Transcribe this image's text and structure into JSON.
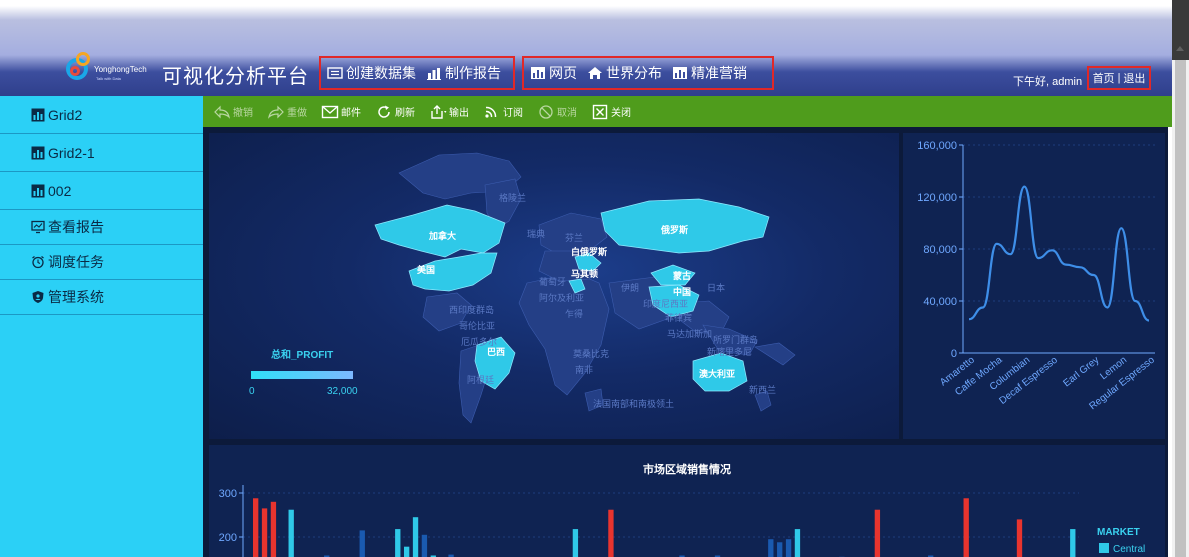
{
  "header": {
    "brand": "YonghongTech",
    "brand_sub": "Talk with Data",
    "title": "可视化分析平台",
    "group1": [
      {
        "label": "创建数据集",
        "icon": "dataset-icon"
      },
      {
        "label": "制作报告",
        "icon": "report-icon"
      }
    ],
    "group2": [
      {
        "label": "网页",
        "icon": "chart-icon"
      },
      {
        "label": "世界分布",
        "icon": "home-icon"
      },
      {
        "label": "精准营销",
        "icon": "chart-icon"
      }
    ],
    "greeting": "下午好, admin",
    "home_link": "首页",
    "separator": "|",
    "logout_link": "退出"
  },
  "sidebar": {
    "items": [
      {
        "label": "Grid2",
        "icon": "chart-icon"
      },
      {
        "label": "Grid2-1",
        "icon": "chart-icon"
      },
      {
        "label": "002",
        "icon": "chart-icon"
      },
      {
        "label": "查看报告",
        "icon": "monitor-icon"
      },
      {
        "label": "调度任务",
        "icon": "alarm-clock-icon"
      },
      {
        "label": "管理系统",
        "icon": "shield-icon"
      }
    ]
  },
  "toolbar": {
    "undo": "撤销",
    "redo": "重做",
    "mail": "邮件",
    "refresh": "刷新",
    "export": "输出",
    "subscribe": "订阅",
    "cancel": "取消",
    "close": "关闭"
  },
  "map": {
    "legend_title": "总和_PROFIT",
    "legend_min": "0",
    "legend_max": "32,000",
    "highlight_color": "#2fc9e8",
    "labels": {
      "canada": "加拿大",
      "usa": "美国",
      "russia": "俄罗斯",
      "belarus": "白俄罗斯",
      "macedonia": "马其顿",
      "mongolia": "蒙古",
      "china": "中国",
      "brazil": "巴西",
      "australia": "澳大利亚",
      "greenland": "格陵兰",
      "sweden": "瑞典",
      "finland": "芬兰",
      "portugal": "葡萄牙",
      "algeria": "阿尔及利亚",
      "chad": "乍得",
      "iran": "伊朗",
      "japan": "日本",
      "india": "印度尼西亚",
      "philippines": "菲律宾",
      "solomon": "所罗门群岛",
      "new_caledonia": "新喀里多尼",
      "madagascar": "马达加斯加",
      "mozambique": "莫桑比克",
      "south_africa": "南非",
      "argentina": "阿根廷",
      "nz": "新西兰",
      "antarctic": "法国南部和南极领土",
      "caribbean": "西印度群岛",
      "colombia": "哥伦比亚",
      "ecuador": "厄瓜多尔"
    }
  },
  "chart_data": [
    {
      "type": "line",
      "categories": [
        "Amaretto",
        "Caffe Mocha",
        "Columbian",
        "Decaf Espresso",
        "Earl Grey",
        "Lemon",
        "Regular Espresso"
      ],
      "x": [
        "Amaretto",
        "",
        "Caffe Mocha",
        "",
        "Columbian",
        "",
        "Decaf Espresso",
        "",
        "",
        "Earl Grey",
        "",
        "Lemon",
        "",
        "Regular Espresso"
      ],
      "values": [
        26000,
        35000,
        84000,
        76000,
        128000,
        73000,
        79000,
        68000,
        66000,
        60000,
        35000,
        96000,
        40000,
        25000
      ],
      "ylim": [
        0,
        160000
      ],
      "yticks": [
        "0",
        "40,000",
        "80,000",
        "120,000",
        "160,000"
      ],
      "color": "#3e8ee8",
      "grid": true
    },
    {
      "type": "bar",
      "title": "市场区域销售情况",
      "ylim": [
        100,
        300
      ],
      "yticks": [
        "200",
        "300"
      ],
      "legend_title": "MARKET",
      "legend": [
        "Central"
      ],
      "legend_colors": [
        "#2fc9e8"
      ],
      "values": [
        288,
        265,
        280,
        0,
        262,
        0,
        150,
        0,
        158,
        0,
        0,
        0,
        215,
        0,
        0,
        0,
        218,
        178,
        245,
        205,
        158,
        0,
        160,
        0,
        0,
        0,
        0,
        0,
        0,
        0,
        0,
        0,
        0,
        0,
        0,
        0,
        218,
        0,
        0,
        0,
        262,
        0,
        0,
        0,
        0,
        0,
        0,
        0,
        158,
        0,
        0,
        0,
        158,
        0,
        0,
        0,
        0,
        0,
        195,
        188,
        195,
        218,
        0,
        0,
        0,
        0,
        155,
        0,
        0,
        0,
        262,
        0,
        0,
        0,
        0,
        0,
        158,
        0,
        0,
        0,
        288,
        0,
        0,
        0,
        0,
        0,
        240,
        0,
        0,
        0,
        0,
        0,
        218
      ],
      "colors": [
        "#e8342e",
        "#e8342e",
        "#e8342e",
        "#0f2352",
        "#2fc9e8",
        "#0f2352",
        "#2fc9e8",
        "#0f2352",
        "#1a5ab0",
        "#0f2352",
        "#0f2352",
        "#0f2352",
        "#1a5ab0",
        "#0f2352",
        "#0f2352",
        "#0f2352",
        "#2fc9e8",
        "#2fc9e8",
        "#2fc9e8",
        "#1a5ab0",
        "#2fc9e8",
        "#0f2352",
        "#1a5ab0",
        "#0f2352",
        "#0f2352",
        "#0f2352",
        "#0f2352",
        "#0f2352",
        "#0f2352",
        "#0f2352",
        "#0f2352",
        "#0f2352",
        "#0f2352",
        "#0f2352",
        "#0f2352",
        "#0f2352",
        "#2fc9e8",
        "#0f2352",
        "#0f2352",
        "#0f2352",
        "#e8342e",
        "#0f2352",
        "#0f2352",
        "#0f2352",
        "#0f2352",
        "#0f2352",
        "#0f2352",
        "#0f2352",
        "#1a5ab0",
        "#0f2352",
        "#0f2352",
        "#0f2352",
        "#1a5ab0",
        "#0f2352",
        "#0f2352",
        "#0f2352",
        "#0f2352",
        "#0f2352",
        "#1a5ab0",
        "#1a5ab0",
        "#1a5ab0",
        "#2fc9e8",
        "#0f2352",
        "#0f2352",
        "#0f2352",
        "#0f2352",
        "#1a5ab0",
        "#0f2352",
        "#0f2352",
        "#0f2352",
        "#e8342e",
        "#0f2352",
        "#0f2352",
        "#0f2352",
        "#0f2352",
        "#0f2352",
        "#1a5ab0",
        "#0f2352",
        "#0f2352",
        "#0f2352",
        "#e8342e",
        "#0f2352",
        "#0f2352",
        "#0f2352",
        "#0f2352",
        "#0f2352",
        "#e8342e",
        "#0f2352",
        "#0f2352",
        "#0f2352",
        "#0f2352",
        "#0f2352",
        "#2fc9e8"
      ]
    }
  ]
}
